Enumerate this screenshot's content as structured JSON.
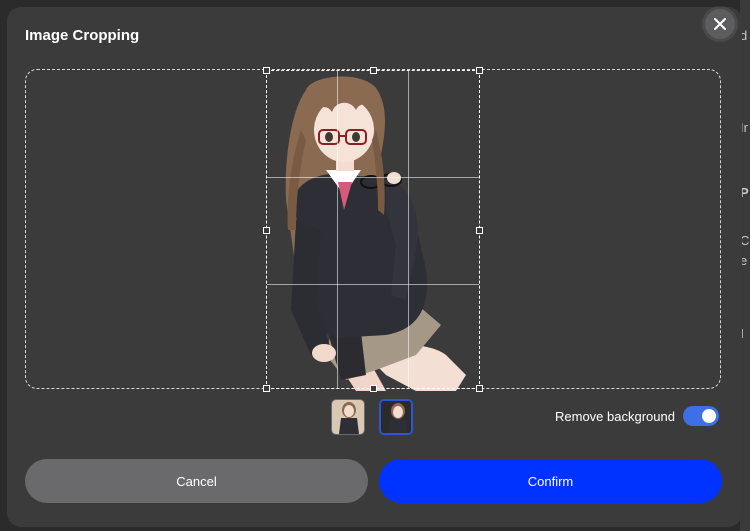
{
  "dialog": {
    "title": "Image Cropping",
    "close_icon": "close-icon"
  },
  "crop": {
    "image_subject": "anime girl with glasses, brown hair, dark cardigan and skirt"
  },
  "thumbnails": [
    {
      "name": "original"
    },
    {
      "name": "background-removed",
      "selected": true
    }
  ],
  "remove_background": {
    "label": "Remove background",
    "enabled": true
  },
  "buttons": {
    "cancel": "Cancel",
    "confirm": "Confirm"
  },
  "background_page": {
    "fragments": [
      "d",
      "e",
      "Ir",
      "P",
      "C",
      "e",
      "I"
    ]
  },
  "colors": {
    "dialog_bg": "#3b3b3c",
    "confirm": "#0033ff",
    "cancel": "#6a6a6c",
    "toggle_on": "#3d6fe6"
  }
}
